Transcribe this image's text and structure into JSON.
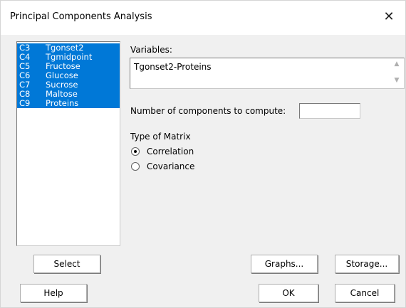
{
  "window": {
    "title": "Principal Components Analysis",
    "close_icon": "close-icon",
    "close_glyph": "✕"
  },
  "variable_list": [
    {
      "col": "C3",
      "name": "Tgonset2"
    },
    {
      "col": "C4",
      "name": "Tgmidpoint"
    },
    {
      "col": "C5",
      "name": "Fructose"
    },
    {
      "col": "C6",
      "name": "Glucose"
    },
    {
      "col": "C7",
      "name": "Sucrose"
    },
    {
      "col": "C8",
      "name": "Maltose"
    },
    {
      "col": "C9",
      "name": "Proteins"
    }
  ],
  "variables": {
    "label": "Variables:",
    "value": "Tgonset2-Proteins"
  },
  "num_components": {
    "label": "Number of components to compute:",
    "value": ""
  },
  "matrix_type": {
    "label": "Type of Matrix",
    "options": [
      {
        "label": "Correlation",
        "selected": true
      },
      {
        "label": "Covariance",
        "selected": false
      }
    ]
  },
  "buttons": {
    "select": "Select",
    "graphs": "Graphs...",
    "storage": "Storage...",
    "help": "Help",
    "ok": "OK",
    "cancel": "Cancel"
  },
  "colors": {
    "selection": "#0078d7",
    "dialog_bg": "#f0f0f0"
  }
}
